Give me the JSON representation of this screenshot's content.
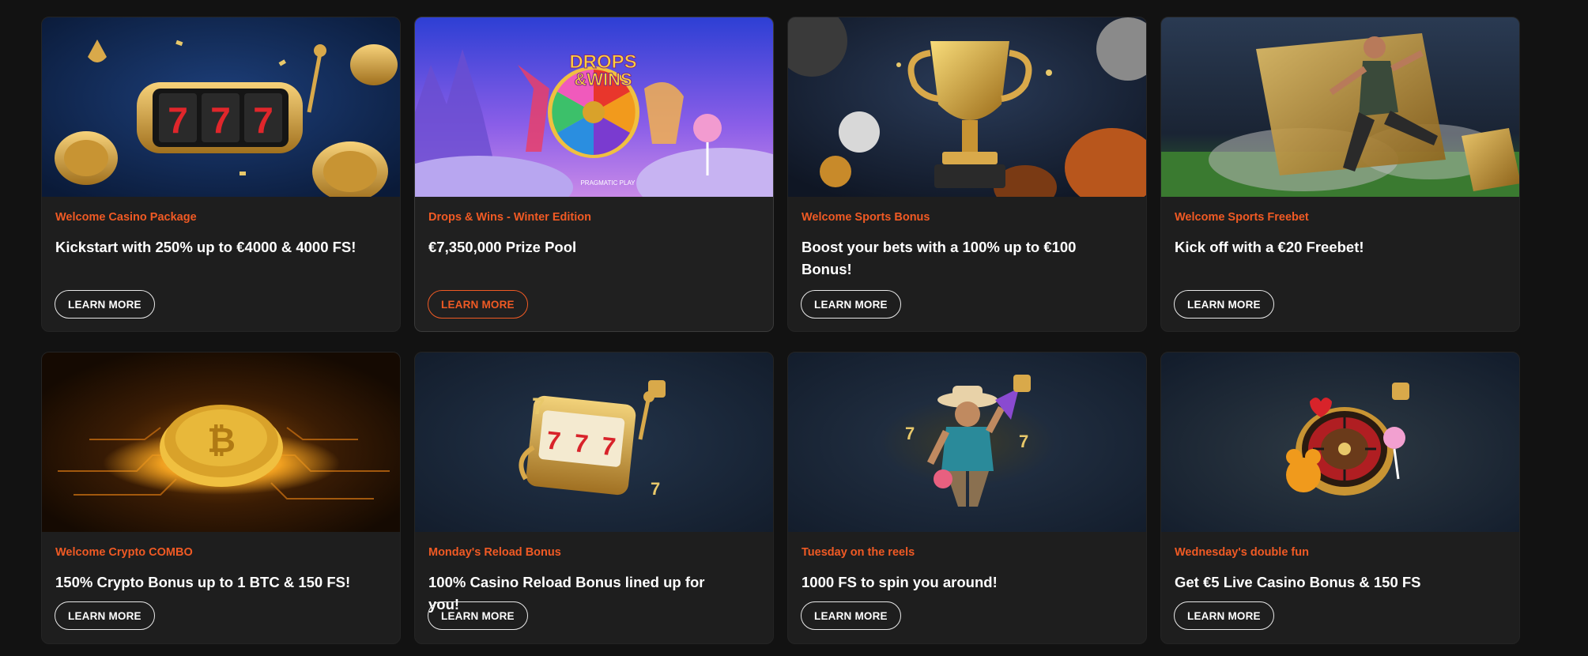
{
  "accent_color": "#f05a24",
  "promotions": [
    {
      "category": "Welcome Casino Package",
      "title": "Kickstart with 250% up to €4000 & 4000 FS!",
      "button": "LEARN MORE",
      "art": "slot-777-icon",
      "reel_digits": [
        "7",
        "7",
        "7"
      ]
    },
    {
      "category": "Drops & Wins - Winter Edition",
      "title": "€7,350,000 Prize Pool",
      "button": "LEARN MORE",
      "art": "prize-wheel-icon",
      "banner_headline_1": "DROPS",
      "banner_headline_2": "&WINS",
      "banner_brand": "PRAGMATIC PLAY"
    },
    {
      "category": "Welcome Sports Bonus",
      "title": "Boost your bets with a 100% up to €100 Bonus!",
      "button": "LEARN MORE",
      "art": "trophy-icon"
    },
    {
      "category": "Welcome Sports Freebet",
      "title": "Kick off with a €20 Freebet!",
      "button": "LEARN MORE",
      "art": "football-player-icon"
    },
    {
      "category": "Welcome Crypto COMBO",
      "title": "150% Crypto Bonus up to 1 BTC & 150 FS!",
      "button": "LEARN MORE",
      "art": "bitcoin-coin-icon",
      "coin_symbol": "₿"
    },
    {
      "category": "Monday's Reload Bonus",
      "title": "100% Casino Reload Bonus lined up for you!",
      "button": "LEARN MORE",
      "art": "slot-machine-icon",
      "reel_digits": [
        "7",
        "7",
        "7"
      ]
    },
    {
      "category": "Tuesday on the reels",
      "title": "1000 FS to spin you around!",
      "button": "LEARN MORE",
      "art": "cowboy-character-icon"
    },
    {
      "category": "Wednesday's double fun",
      "title": "Get €5 Live Casino Bonus & 150 FS",
      "button": "LEARN MORE",
      "art": "roulette-wheel-icon"
    }
  ]
}
